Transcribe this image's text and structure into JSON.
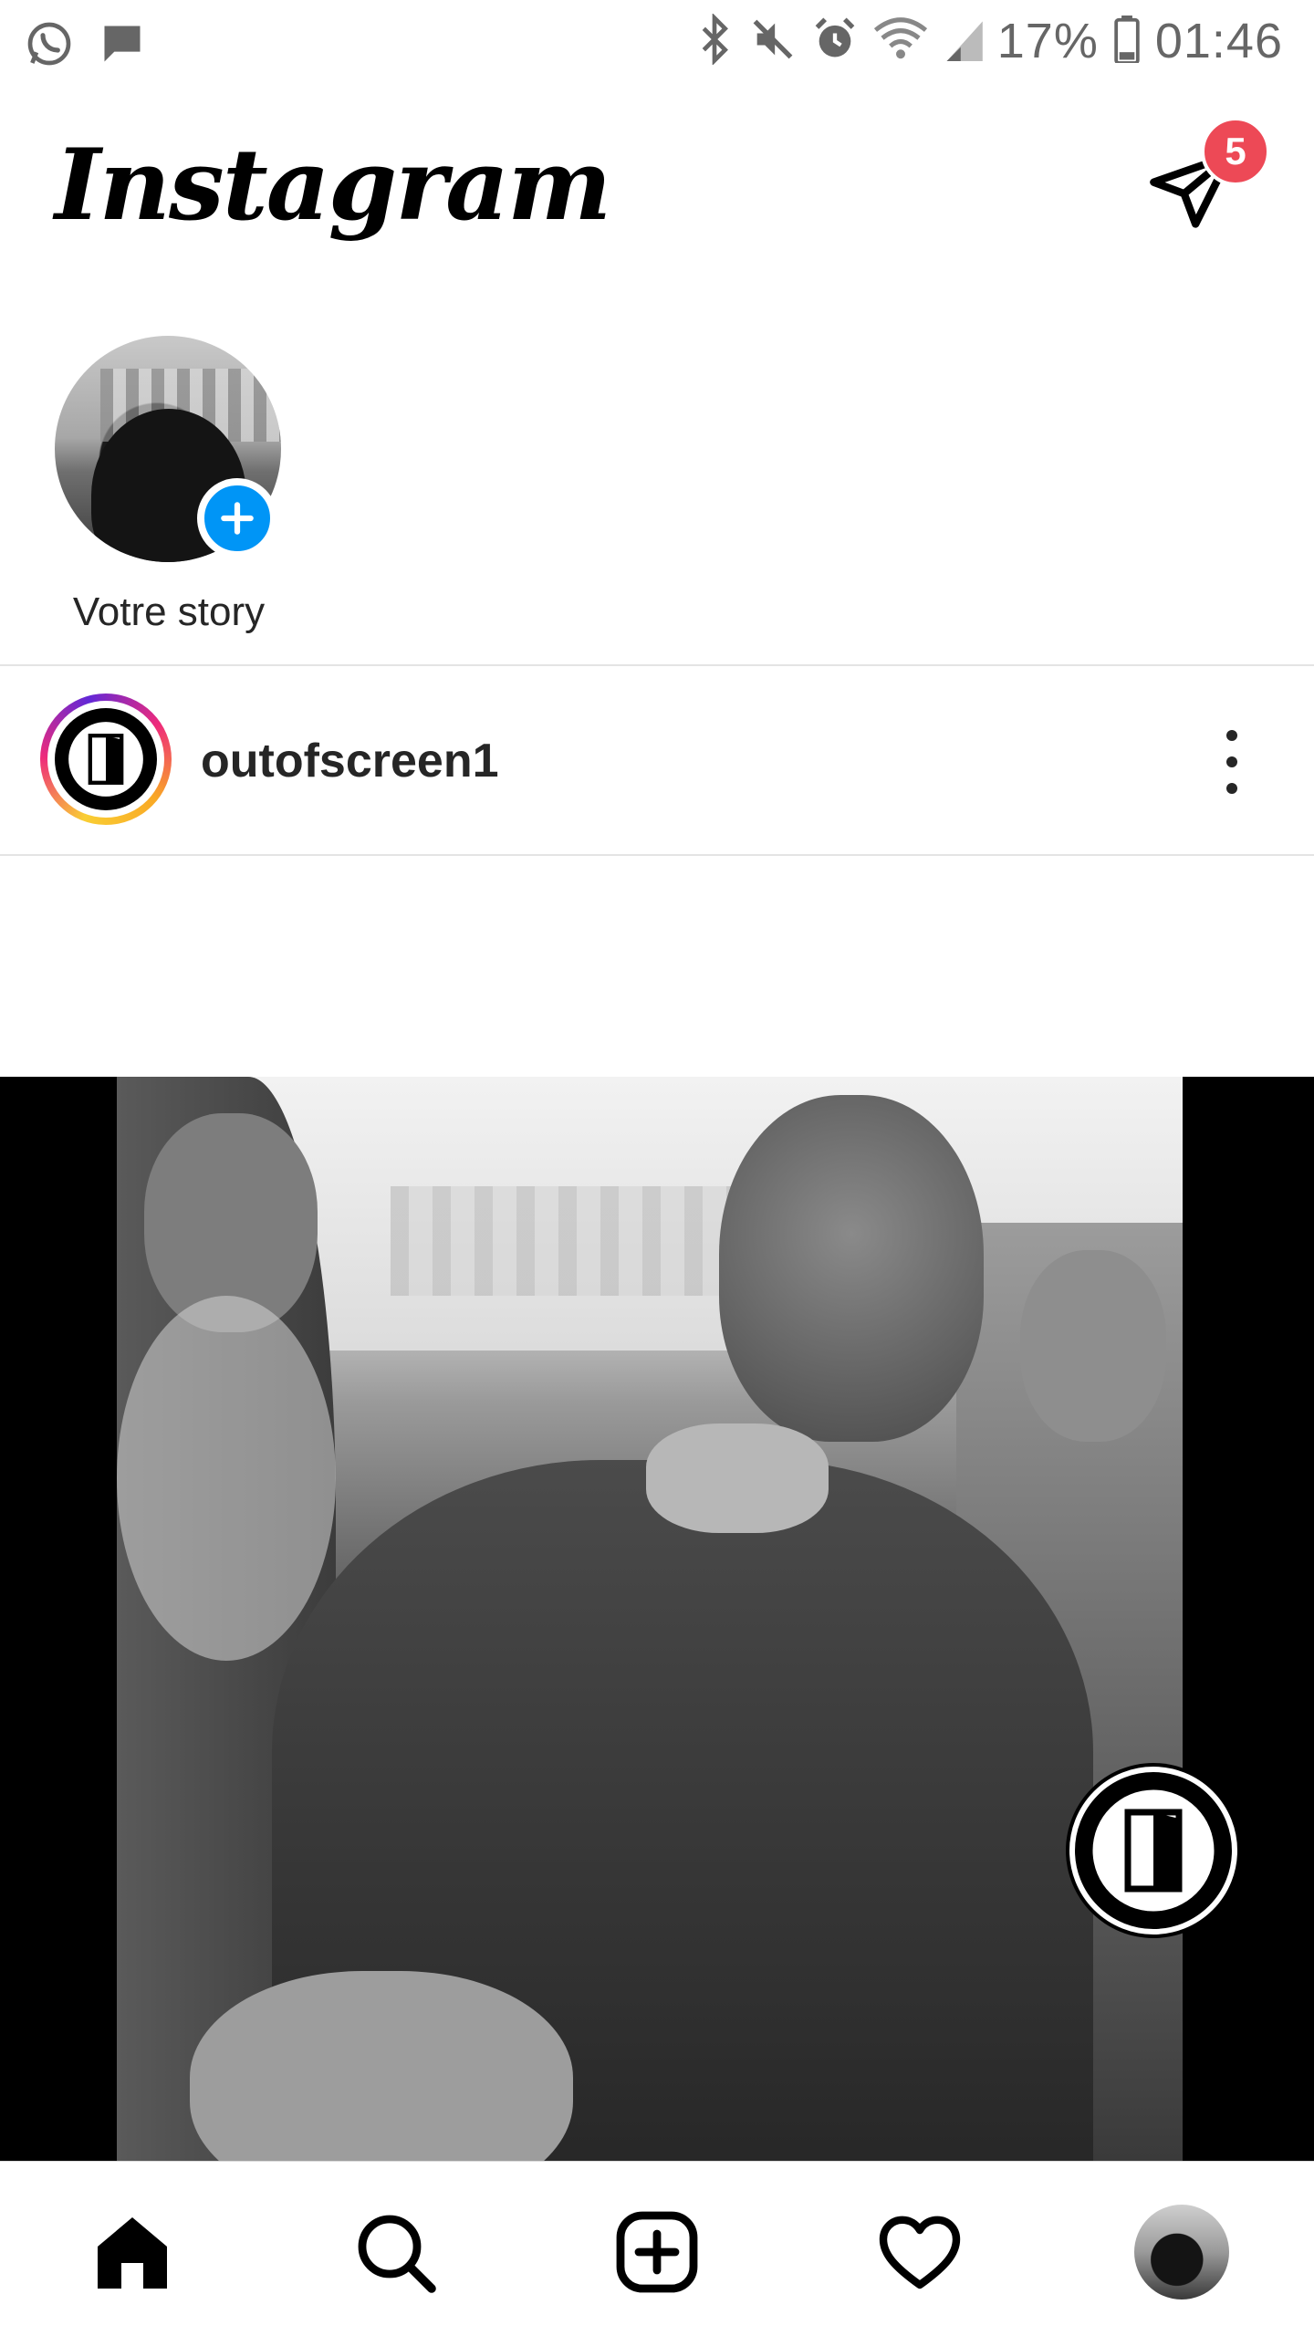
{
  "status_bar": {
    "battery_percent": "17%",
    "time": "01:46",
    "left_icons": [
      "whatsapp-icon",
      "message-icon"
    ],
    "right_icons": [
      "bluetooth-icon",
      "mute-icon",
      "alarm-icon",
      "wifi-icon",
      "signal-icon",
      "battery-icon"
    ]
  },
  "header": {
    "logo": "Instagram",
    "dm_badge_count": "5",
    "badge_color": "#ed4956"
  },
  "stories": {
    "items": [
      {
        "label": "Votre story"
      }
    ],
    "add_button_color": "#0095f6"
  },
  "post": {
    "username": "outofscreen1",
    "more_icon": "more-vertical-icon"
  },
  "bottom_nav": {
    "items": [
      "home-icon",
      "search-icon",
      "add-post-icon",
      "heart-icon",
      "profile-avatar"
    ]
  }
}
